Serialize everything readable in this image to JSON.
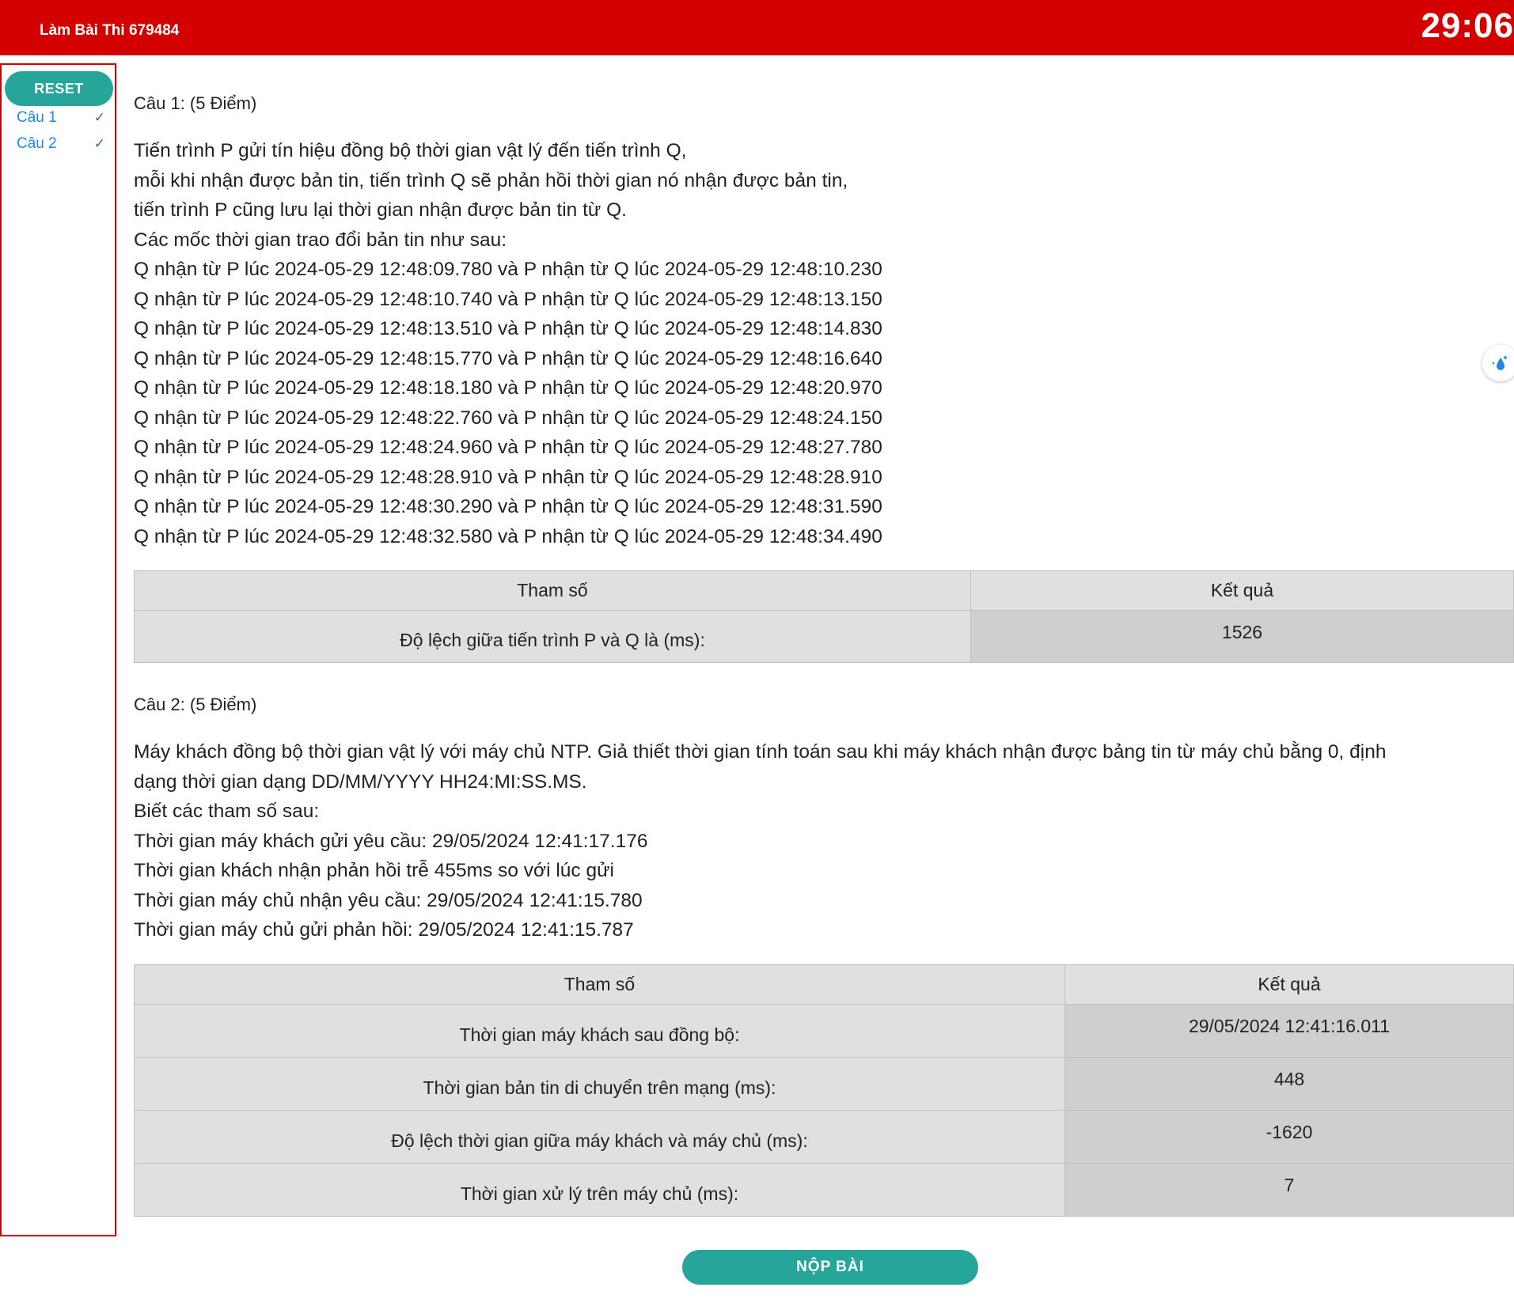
{
  "header": {
    "title": "Làm Bài Thi 679484",
    "timer": "29:06"
  },
  "sidebar": {
    "reset_label": "RESET",
    "items": [
      {
        "label": "Câu 1",
        "status_icon": "check-icon"
      },
      {
        "label": "Câu 2",
        "status_icon": "check-icon"
      }
    ]
  },
  "q1": {
    "heading": "Câu 1: (5 Điểm)",
    "lines": [
      "Tiến trình P gửi tín hiệu đồng bộ thời gian vật lý đến tiến trình Q,",
      "mỗi khi nhận được bản tin, tiến trình Q sẽ phản hồi thời gian nó nhận được bản tin,",
      "tiến trình P cũng lưu lại thời gian nhận được bản tin từ Q.",
      "Các mốc thời gian trao đổi bản tin như sau:",
      "Q nhận từ P lúc 2024-05-29 12:48:09.780 và P nhận từ Q lúc 2024-05-29 12:48:10.230",
      "Q nhận từ P lúc 2024-05-29 12:48:10.740 và P nhận từ Q lúc 2024-05-29 12:48:13.150",
      "Q nhận từ P lúc 2024-05-29 12:48:13.510 và P nhận từ Q lúc 2024-05-29 12:48:14.830",
      "Q nhận từ P lúc 2024-05-29 12:48:15.770 và P nhận từ Q lúc 2024-05-29 12:48:16.640",
      "Q nhận từ P lúc 2024-05-29 12:48:18.180 và P nhận từ Q lúc 2024-05-29 12:48:20.970",
      "Q nhận từ P lúc 2024-05-29 12:48:22.760 và P nhận từ Q lúc 2024-05-29 12:48:24.150",
      "Q nhận từ P lúc 2024-05-29 12:48:24.960 và P nhận từ Q lúc 2024-05-29 12:48:27.780",
      "Q nhận từ P lúc 2024-05-29 12:48:28.910 và P nhận từ Q lúc 2024-05-29 12:48:28.910",
      "Q nhận từ P lúc 2024-05-29 12:48:30.290 và P nhận từ Q lúc 2024-05-29 12:48:31.590",
      "Q nhận từ P lúc 2024-05-29 12:48:32.580 và P nhận từ Q lúc 2024-05-29 12:48:34.490"
    ],
    "table": {
      "headers": [
        "Tham số",
        "Kết quả"
      ],
      "rows": [
        {
          "param": "Độ lệch giữa tiến trình P và Q là (ms):",
          "value": "1526"
        }
      ]
    }
  },
  "q2": {
    "heading": "Câu 2: (5 Điểm)",
    "lines": [
      "Máy khách đồng bộ thời gian vật lý với máy chủ NTP. Giả thiết thời gian tính toán sau khi máy khách nhận được bảng tin từ máy chủ bằng 0, định",
      "dạng thời gian dạng DD/MM/YYYY HH24:MI:SS.MS.",
      "Biết các tham số sau:",
      "Thời gian máy khách gửi yêu cầu: 29/05/2024 12:41:17.176",
      "Thời gian khách nhận phản hồi trễ 455ms so với lúc gửi",
      "Thời gian máy chủ nhận yêu cầu: 29/05/2024 12:41:15.780",
      "Thời gian máy chủ gửi phản hồi: 29/05/2024 12:41:15.787"
    ],
    "table": {
      "headers": [
        "Tham số",
        "Kết quả"
      ],
      "rows": [
        {
          "param": "Thời gian máy khách sau đồng bộ:",
          "value": "29/05/2024 12:41:16.011"
        },
        {
          "param": "Thời gian bản tin di chuyển trên mạng (ms):",
          "value": "448"
        },
        {
          "param": "Độ lệch thời gian giữa máy khách và máy chủ (ms):",
          "value": "-1620"
        },
        {
          "param": "Thời gian xử lý trên máy chủ (ms):",
          "value": "7"
        }
      ]
    }
  },
  "footer": {
    "submit_label": "NỘP BÀI"
  },
  "colors": {
    "header_bg": "#d40000",
    "accent": "#26a69a",
    "link": "#1e88e5",
    "check": "#2e7d32"
  }
}
